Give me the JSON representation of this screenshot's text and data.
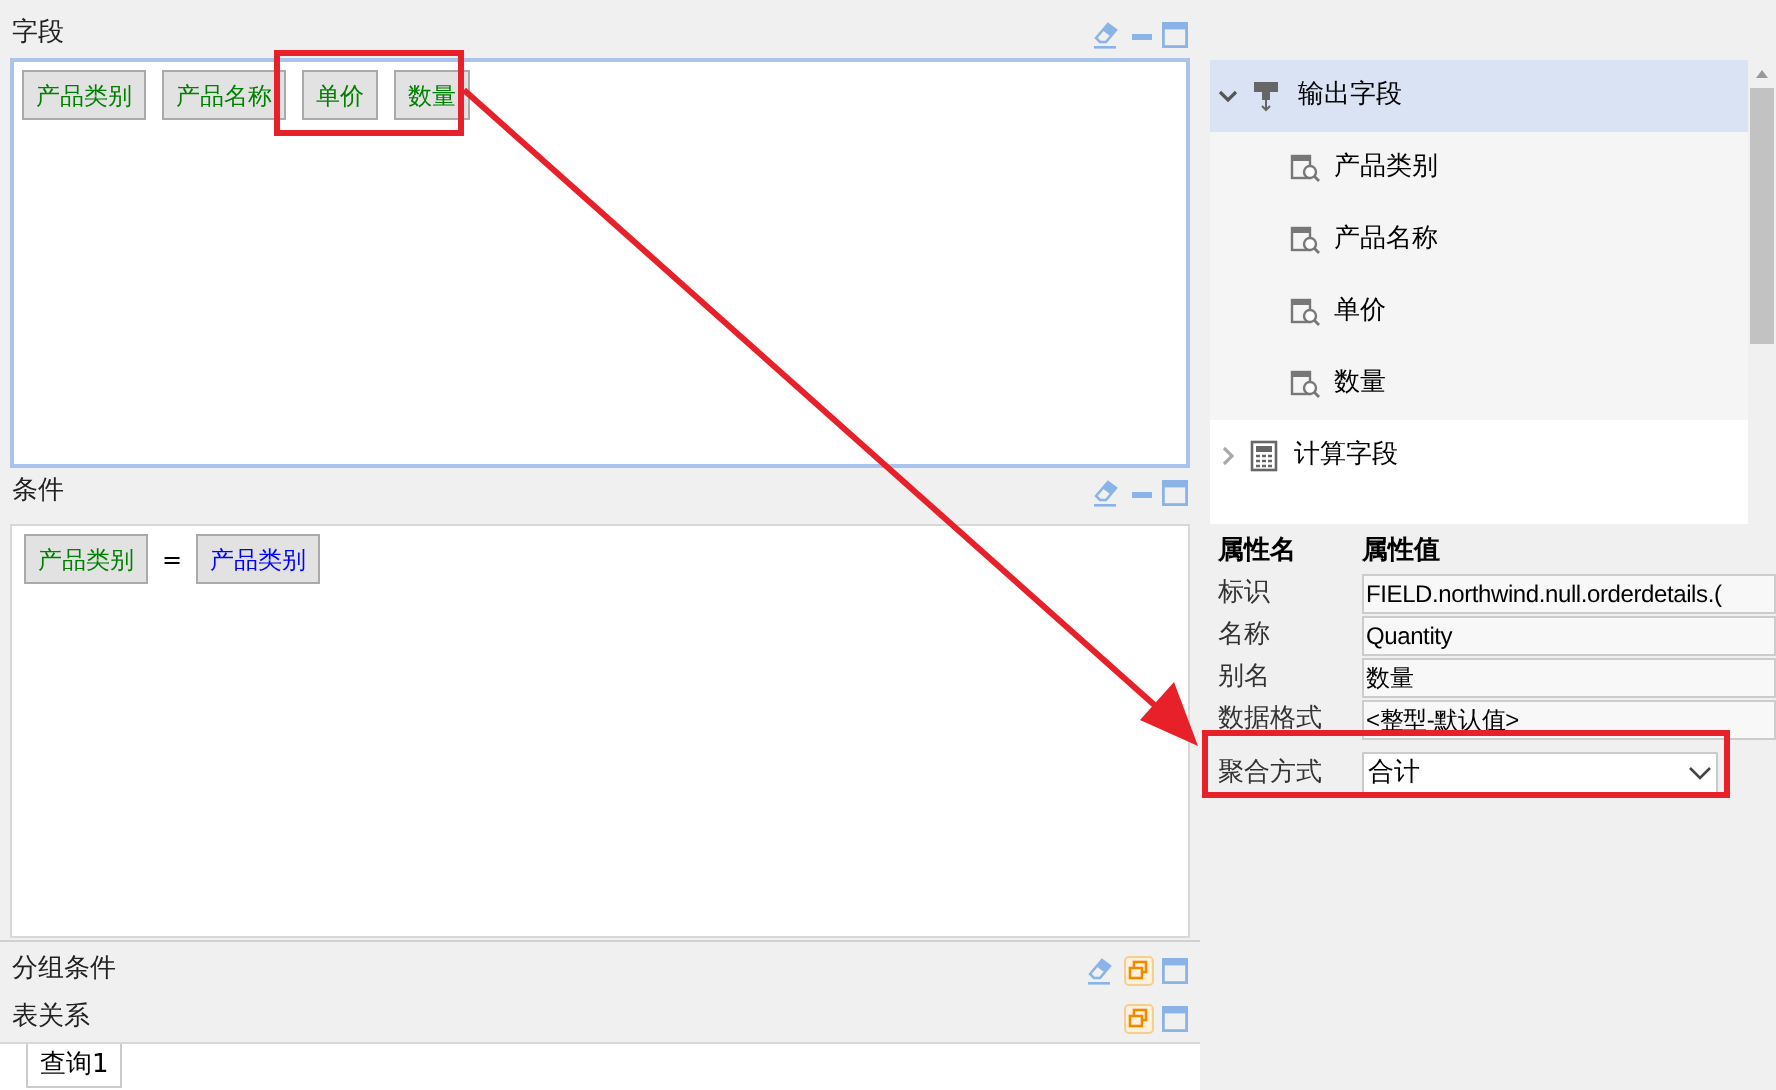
{
  "fields_panel": {
    "title": "字段",
    "clearable": true,
    "restored": false,
    "chips": [
      {
        "label": "产品类别",
        "color": "#008000"
      },
      {
        "label": "产品名称",
        "color": "#008000"
      },
      {
        "label": "单价",
        "color": "#008000"
      },
      {
        "label": "数量",
        "color": "#008000"
      }
    ]
  },
  "conditions_panel": {
    "title": "条件",
    "clearable": true,
    "restored": false,
    "left": {
      "label": "产品类别",
      "color": "#008000"
    },
    "operator": "=",
    "right": {
      "label": "产品类别",
      "color": "#0000ff"
    }
  },
  "group_panel": {
    "title": "分组条件",
    "clearable": true,
    "restored": true
  },
  "relations_panel": {
    "title": "表关系",
    "clearable": false,
    "restored": true,
    "tabs": [
      {
        "label": "查询1",
        "selected": true
      }
    ]
  },
  "tree": [
    {
      "label": "输出字段",
      "kind": "output",
      "expanded": true,
      "selected": true,
      "children": [
        {
          "label": "产品类别"
        },
        {
          "label": "产品名称"
        },
        {
          "label": "单价"
        },
        {
          "label": "数量"
        }
      ]
    },
    {
      "label": "计算字段",
      "kind": "calc",
      "expanded": false,
      "selected": false
    }
  ],
  "properties": {
    "header_name": "属性名",
    "header_value": "属性值",
    "rows": [
      {
        "name": "标识",
        "value": "FIELD.northwind.null.orderdetails.(",
        "kind": "text"
      },
      {
        "name": "名称",
        "value": "Quantity",
        "kind": "text"
      },
      {
        "name": "别名",
        "value": "数量",
        "kind": "text"
      },
      {
        "name": "数据格式",
        "value": "<整型-默认值>",
        "kind": "text"
      },
      {
        "name": "聚合方式",
        "value": "合计",
        "kind": "select"
      }
    ]
  }
}
